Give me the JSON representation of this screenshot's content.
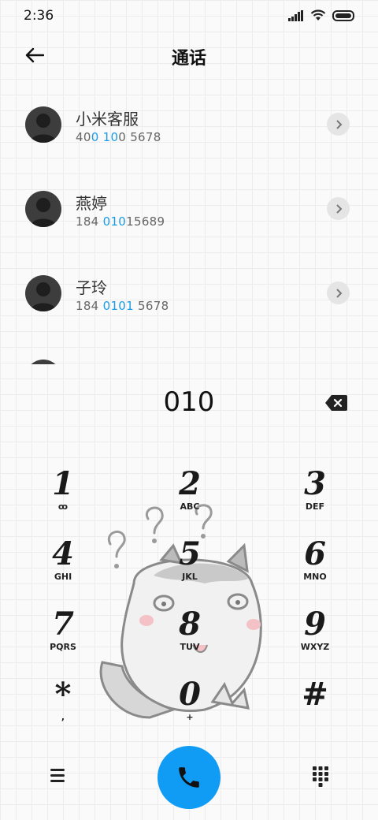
{
  "status": {
    "time": "2:36"
  },
  "header": {
    "title": "通话"
  },
  "contacts": [
    {
      "name": "小米客服",
      "num_a": "40",
      "num_b": "0 10",
      "num_c": "0 5678"
    },
    {
      "name": "燕婷",
      "num_a": "184 ",
      "num_b": "010",
      "num_c": "15689"
    },
    {
      "name": "子玲",
      "num_a": "184 ",
      "num_b": "0101",
      "num_c": " 5678"
    }
  ],
  "dialer": {
    "input": "010",
    "keys": [
      {
        "digit": "1",
        "letters": "ꝏ"
      },
      {
        "digit": "2",
        "letters": "ABC"
      },
      {
        "digit": "3",
        "letters": "DEF"
      },
      {
        "digit": "4",
        "letters": "GHI"
      },
      {
        "digit": "5",
        "letters": "JKL"
      },
      {
        "digit": "6",
        "letters": "MNO"
      },
      {
        "digit": "7",
        "letters": "PQRS"
      },
      {
        "digit": "8",
        "letters": "TUV"
      },
      {
        "digit": "9",
        "letters": "WXYZ"
      },
      {
        "digit": "*",
        "letters": ","
      },
      {
        "digit": "0",
        "letters": "+"
      },
      {
        "digit": "#",
        "letters": ""
      }
    ]
  },
  "icons": {
    "back": "back-arrow-icon",
    "detail": "chevron-right-icon",
    "backspace": "backspace-icon",
    "menu": "menu-icon",
    "call": "phone-icon",
    "keypad": "dialpad-icon"
  },
  "colors": {
    "accent": "#109cf5",
    "highlight": "#1a9be8"
  }
}
